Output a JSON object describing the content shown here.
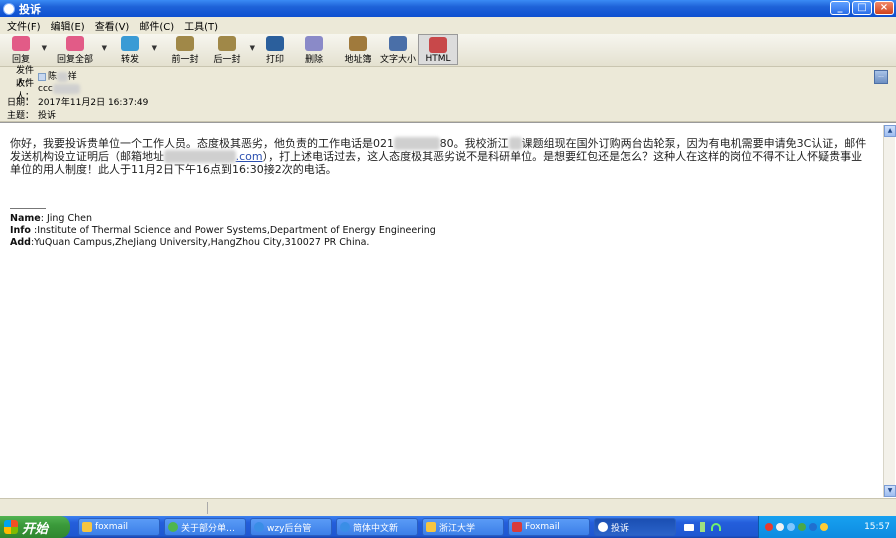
{
  "window": {
    "title": "投诉"
  },
  "menu": [
    "文件(F)",
    "编辑(E)",
    "查看(V)",
    "邮件(C)",
    "工具(T)"
  ],
  "toolbar": [
    {
      "label": "回复",
      "icon": "reply-icon",
      "color": "#e25b87",
      "dropdown": true
    },
    {
      "label": "回复全部",
      "icon": "reply-all-icon",
      "color": "#e25b87",
      "dropdown": true
    },
    {
      "label": "转发",
      "icon": "forward-icon",
      "color": "#3a9bd5",
      "dropdown": true
    },
    {
      "label": "前一封",
      "icon": "previous-icon",
      "color": "#a08848",
      "dropdown": false
    },
    {
      "label": "后一封",
      "icon": "next-icon",
      "color": "#a08848",
      "dropdown": true
    },
    {
      "label": "打印",
      "icon": "printer-icon",
      "color": "#2b5f9c",
      "dropdown": false
    },
    {
      "label": "删除",
      "icon": "delete-icon",
      "color": "#8a8ac8",
      "dropdown": false
    },
    {
      "label": "地址簿",
      "icon": "address-book-icon",
      "color": "#a07a3c",
      "dropdown": false
    },
    {
      "label": "文字大小",
      "icon": "text-size-icon",
      "color": "#4a6fa8",
      "dropdown": false
    },
    {
      "label": "HTML",
      "icon": "html-icon",
      "color": "#c8484a",
      "dropdown": false
    }
  ],
  "headers": {
    "from_label": "发件人：",
    "from_value": "陈",
    "from_value_tail": "祥",
    "to_label": "收件人：",
    "to_value": "ccc",
    "date_label": "日期：",
    "date_value": "2017年11月2日 16:37:49",
    "subject_label": "主题：",
    "subject_value": "投诉"
  },
  "body": {
    "p1": "你好，我要投诉贵单位一个工作人员。态度极其恶劣，他负责的工作电话是021",
    "p1_tail": "80。我校浙江",
    "p1_after": "课题组现在国外订购两台齿轮泵，因为有电机需要申请免3C认证，邮件发送机构设立证明后（邮箱地址",
    "p1_mail_tail": ".com",
    "p1_end": "），打上述电话过去，这人态度极其恶劣说不是科研单位。是想要红包还是怎么？这种人在这样的岗位不得不让人怀疑贵事业单位的用人制度！此人于11月2日下午16点到16:30接2次的电话。"
  },
  "signature": {
    "name_label": "Name",
    "name_value": ": Jing Chen",
    "info_label": "Info",
    "info_value": " :Institute of Thermal Science and Power Systems,Department of Energy Engineering",
    "add_label": "Add",
    "add_value": ":YuQuan Campus,ZheJiang University,HangZhou City,310027 PR China."
  },
  "taskbar": {
    "start_label": "开始",
    "tasks": [
      {
        "label": "foxmail",
        "color": "#f5c542"
      },
      {
        "label": "关于部分单…",
        "color": "#4fb54f"
      },
      {
        "label": "wzy后台管",
        "color": "#3a8ee6"
      },
      {
        "label": "简体中文新",
        "color": "#3a8ee6"
      },
      {
        "label": "浙江大学",
        "color": "#f5c542"
      },
      {
        "label": "Foxmail",
        "color": "#d83b3b"
      },
      {
        "label": "投诉",
        "color": "#ffffff"
      }
    ],
    "clock": "15:57"
  }
}
